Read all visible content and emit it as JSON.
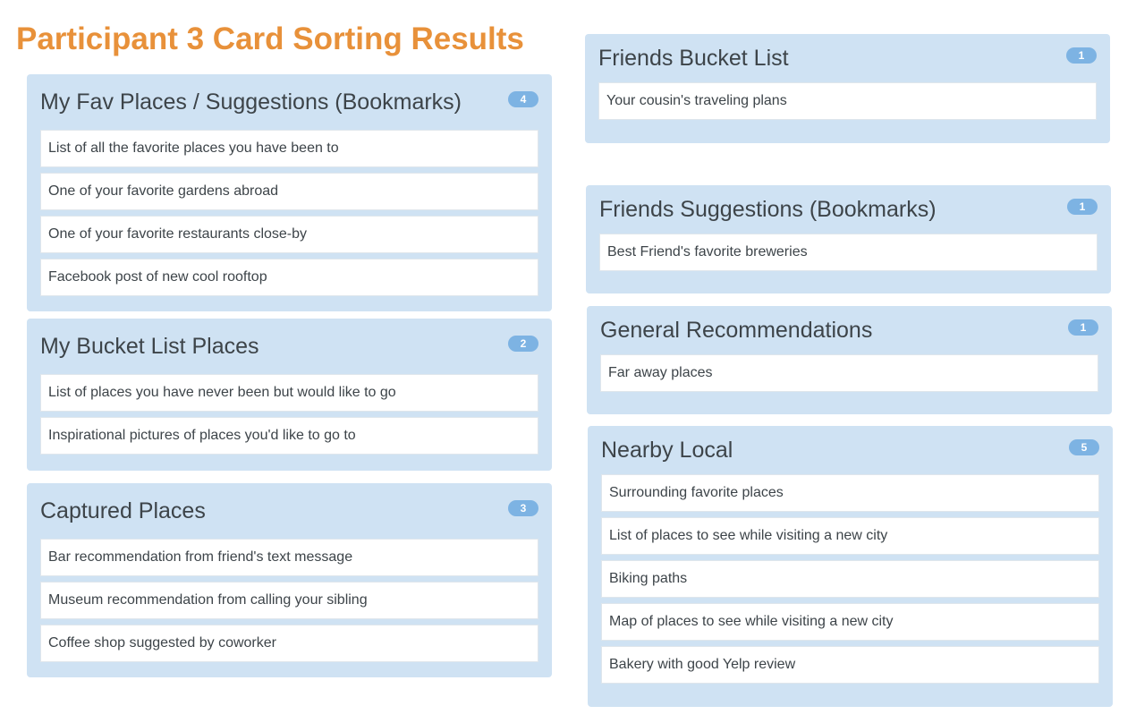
{
  "title": "Participant 3 Card Sorting Results",
  "groups": [
    {
      "name": "My Fav Places / Suggestions (Bookmarks)",
      "count": "4",
      "cards": [
        "List of all the favorite places you have been to",
        "One of your favorite gardens abroad",
        "One of your favorite restaurants close-by",
        "Facebook post of new cool rooftop"
      ]
    },
    {
      "name": "My Bucket List Places",
      "count": "2",
      "cards": [
        "List of places you have never been but would like to go",
        "Inspirational pictures of places you'd like to go to"
      ]
    },
    {
      "name": "Captured Places",
      "count": "3",
      "cards": [
        "Bar recommendation from friend's text message",
        "Museum recommendation from calling your sibling",
        "Coffee shop suggested by coworker"
      ]
    },
    {
      "name": "Friends Bucket List",
      "count": "1",
      "cards": [
        "Your cousin's traveling plans"
      ]
    },
    {
      "name": "Friends Suggestions (Bookmarks)",
      "count": "1",
      "cards": [
        "Best Friend's favorite breweries"
      ]
    },
    {
      "name": "General Recommendations",
      "count": "1",
      "cards": [
        "Far away places"
      ]
    },
    {
      "name": "Nearby Local",
      "count": "5",
      "cards": [
        "Surrounding favorite places",
        "List of places to see while visiting a new city",
        "Biking paths",
        "Map of places to see while visiting a new city",
        "Bakery with good Yelp review"
      ]
    }
  ]
}
